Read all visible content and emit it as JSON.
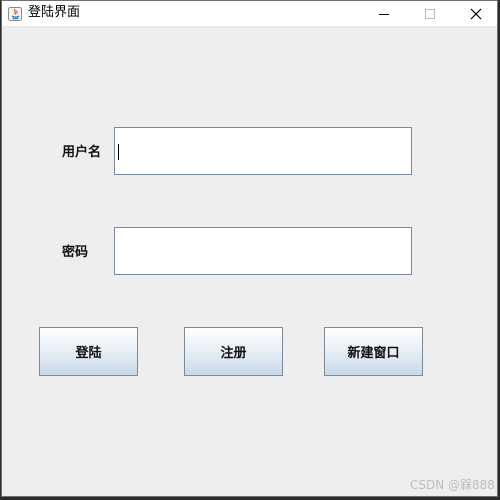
{
  "window": {
    "title": "登陆界面",
    "app_icon": "java-icon",
    "controls": {
      "minimize_icon": "minimize-icon",
      "maximize_icon": "maximize-icon",
      "close_icon": "close-icon"
    }
  },
  "form": {
    "username_label": "用户名",
    "username_value": "",
    "password_label": "密码",
    "password_value": ""
  },
  "buttons": {
    "login": "登陆",
    "register": "注册",
    "new_window": "新建窗口"
  },
  "watermark": "CSDN @槑888",
  "colors": {
    "window_bg": "#eeeeee",
    "titlebar_bg": "#ffffff",
    "field_border": "#7a8a9e",
    "button_border": "#7a8a99"
  }
}
